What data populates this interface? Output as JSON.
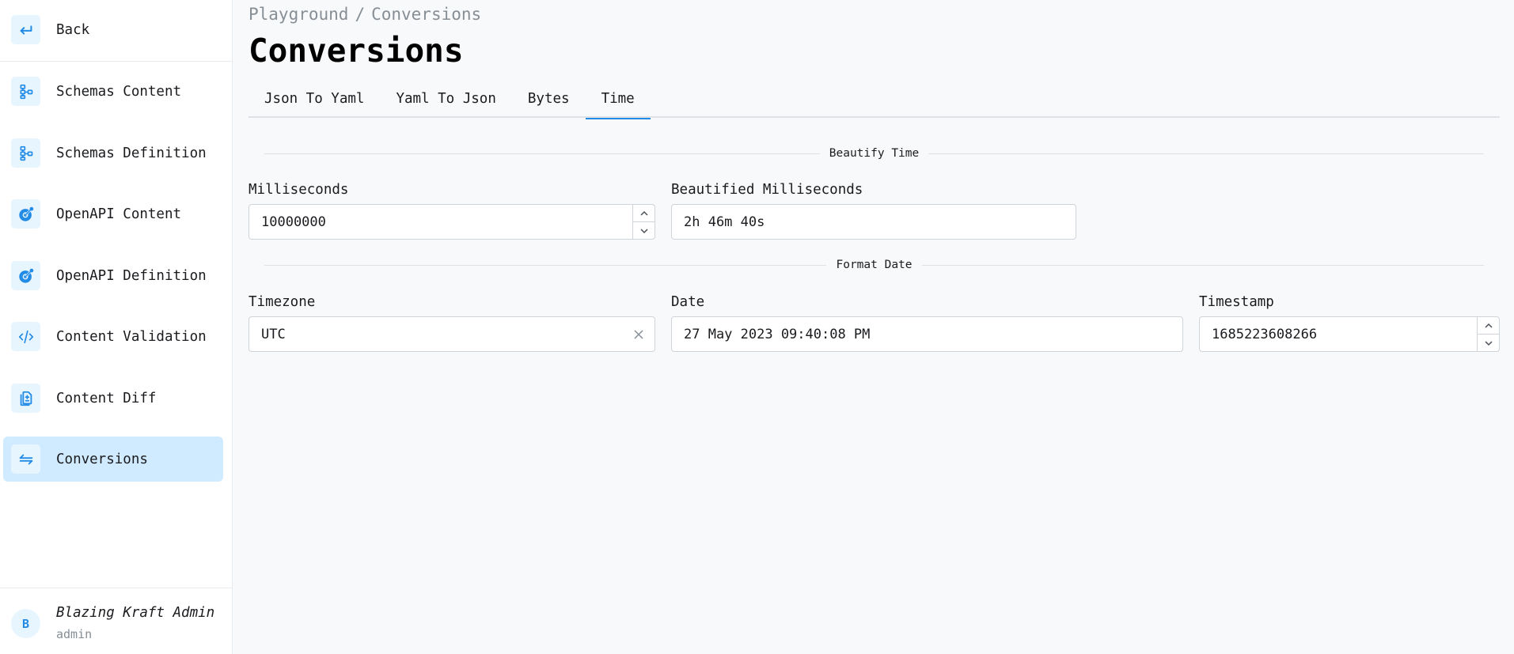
{
  "sidebar": {
    "back": {
      "label": "Back",
      "icon": "arrow-back-icon"
    },
    "items": [
      {
        "label": "Schemas Content",
        "icon": "schema-icon",
        "active": false
      },
      {
        "label": "Schemas Definition",
        "icon": "schema-icon",
        "active": false
      },
      {
        "label": "OpenAPI Content",
        "icon": "openapi-icon",
        "active": false
      },
      {
        "label": "OpenAPI Definition",
        "icon": "openapi-icon",
        "active": false
      },
      {
        "label": "Content Validation",
        "icon": "code-icon",
        "active": false
      },
      {
        "label": "Content Diff",
        "icon": "file-diff-icon",
        "active": false
      },
      {
        "label": "Conversions",
        "icon": "arrows-exchange-icon",
        "active": true
      }
    ],
    "user": {
      "initial": "B",
      "name": "Blazing Kraft Admin",
      "role": "admin"
    }
  },
  "header": {
    "breadcrumb": [
      "Playground",
      "Conversions"
    ],
    "breadcrumb_separator": "/",
    "title": "Conversions"
  },
  "tabs": [
    {
      "label": "Json To Yaml",
      "active": false
    },
    {
      "label": "Yaml To Json",
      "active": false
    },
    {
      "label": "Bytes",
      "active": false
    },
    {
      "label": "Time",
      "active": true
    }
  ],
  "accent_color": "#228be6",
  "beautify": {
    "section_title": "Beautify Time",
    "milliseconds": {
      "label": "Milliseconds",
      "value": "10000000"
    },
    "beautified": {
      "label": "Beautified Milliseconds",
      "value": "2h 46m 40s"
    }
  },
  "format_date": {
    "section_title": "Format Date",
    "timezone": {
      "label": "Timezone",
      "value": "UTC"
    },
    "date": {
      "label": "Date",
      "value": "27 May 2023 09:40:08 PM"
    },
    "timestamp": {
      "label": "Timestamp",
      "value": "1685223608266"
    }
  }
}
